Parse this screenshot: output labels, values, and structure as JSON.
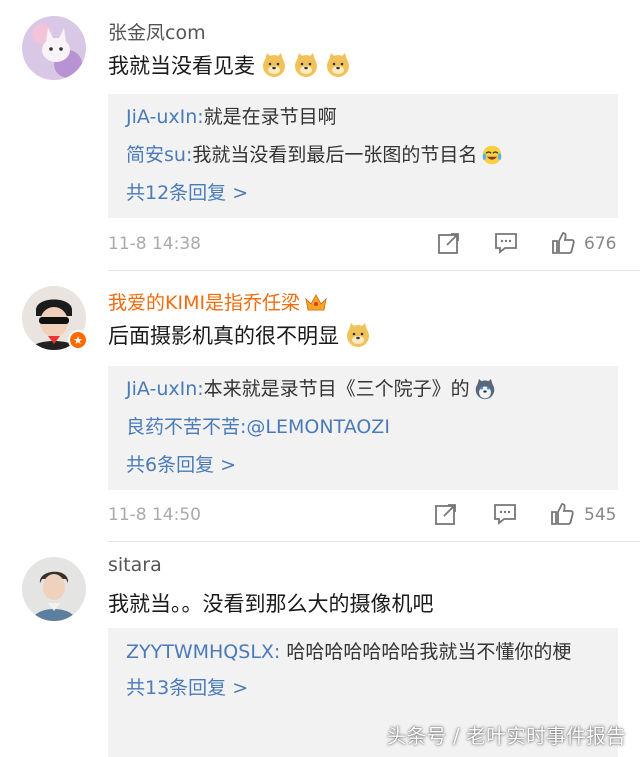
{
  "comments": [
    {
      "username": "张金凤com",
      "text": "我就当没看见麦",
      "emojis": [
        "doge-emoji",
        "doge-emoji",
        "doge-emoji"
      ],
      "replies": [
        {
          "user": "JiA-uxIn:",
          "text": " 就是在录节目啊"
        },
        {
          "user": "简安su:",
          "text": " 我就当没看到最后一张图的节目名",
          "emoji": "laugh-cry-emoji"
        }
      ],
      "more_replies": "共12条回复 >",
      "time": "11-8 14:38",
      "likes": "676"
    },
    {
      "username": "我爱的KIMI是指乔任梁",
      "username_badge": "crown-icon",
      "text": "后面摄影机真的很不明显",
      "emojis": [
        "doge-emoji"
      ],
      "replies": [
        {
          "user": "JiA-uxIn:",
          "text": " 本来就是录节目《三个院子》的",
          "emoji": "husky-emoji"
        },
        {
          "user": "良药不苦不苦:",
          "text": " @LEMONTAOZI"
        }
      ],
      "more_replies": "共6条回复 >",
      "time": "11-8 14:50",
      "likes": "545"
    },
    {
      "username": "sitara",
      "text": "我就当。。没看到那么大的摄像机吧",
      "replies": [
        {
          "user": "ZYYTWMHQSLX:",
          "text": " 哈哈哈哈哈哈哈我就当不懂你的梗"
        }
      ],
      "more_replies": "共13条回复 >"
    }
  ],
  "watermark": "头条号 / 老叶实时事件报告",
  "colors": {
    "link_blue": "#4a7bb8",
    "vip_orange": "#f26c0d",
    "reply_bg": "#f2f2f2",
    "meta_gray": "#aaaaaa"
  }
}
